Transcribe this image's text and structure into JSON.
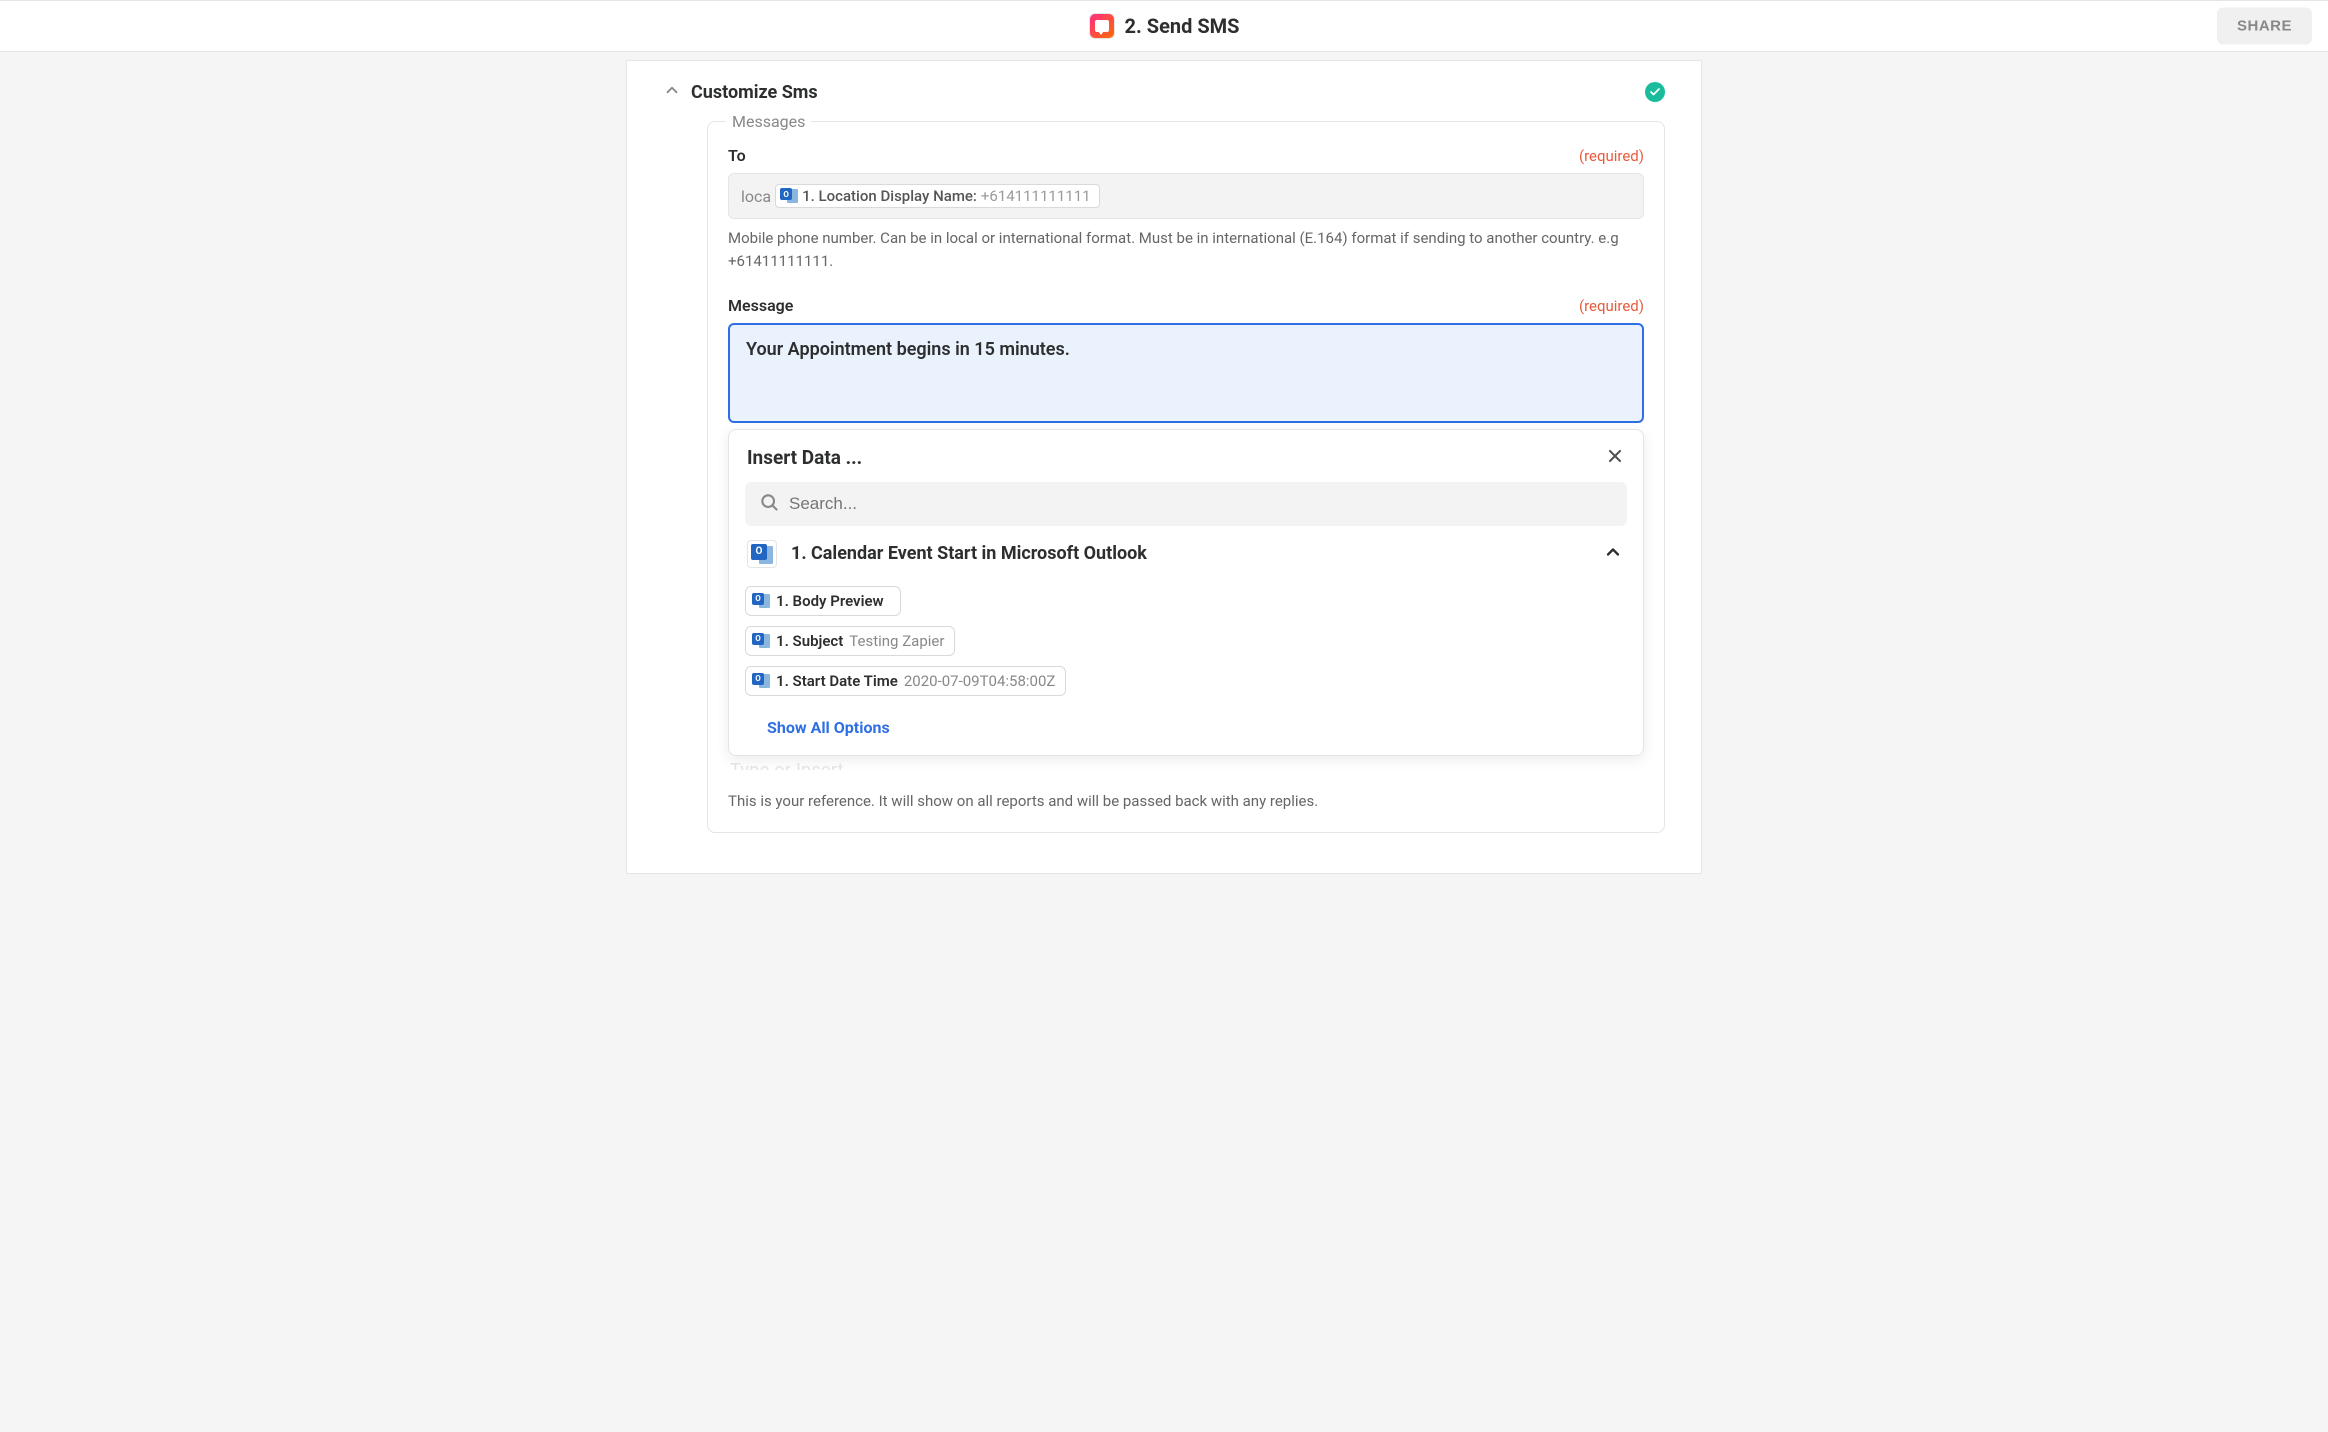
{
  "topbar": {
    "title": "2. Send SMS",
    "share": "SHARE"
  },
  "section": {
    "title": "Customize Sms"
  },
  "fieldset": {
    "legend": "Messages"
  },
  "to_field": {
    "label": "To",
    "required": "(required)",
    "typed_prefix": "loca",
    "token_label": "1. Location Display Name:",
    "token_value": "+614111111111",
    "help": "Mobile phone number. Can be in local or international format. Must be in international (E.164) format if sending to another country. e.g +61411111111."
  },
  "message_field": {
    "label": "Message",
    "required": "(required)",
    "value": "Your Appointment begins in 15 minutes."
  },
  "dropdown": {
    "title": "Insert Data ...",
    "search_placeholder": "Search...",
    "source": "1. Calendar Event Start in Microsoft Outlook",
    "options": {
      "0": {
        "label": "1. Body Preview",
        "value": ""
      },
      "1": {
        "label": "1. Subject",
        "value": "Testing Zapier"
      },
      "2": {
        "label": "1. Start Date Time",
        "value": "2020-07-09T04:58:00Z"
      }
    },
    "show_all": "Show All Options"
  },
  "under": {
    "covered_text": "Type or Insert..."
  },
  "reference": {
    "help": "This is your reference. It will show on all reports and will be passed back with any replies."
  }
}
